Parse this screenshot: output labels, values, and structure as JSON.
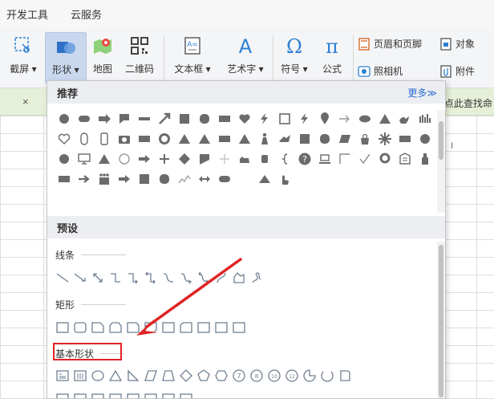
{
  "menu": {
    "dev_tools": "开发工具",
    "cloud": "云服务"
  },
  "ribbon": {
    "screenshot": "截屏",
    "shapes": "形状",
    "map": "地图",
    "qrcode": "二维码",
    "textbox": "文本框",
    "wordart": "艺术字",
    "symbol": "符号",
    "formula": "公式",
    "header_footer": "页眉和页脚",
    "object": "对象",
    "camera": "照相机",
    "attachment": "附件",
    "dropdown_arrow": "▾"
  },
  "sheet": {
    "close_tab": "×",
    "find_text": "点此查找命",
    "col_letter": "I"
  },
  "popup": {
    "recommended_title": "推荐",
    "more_link": "更多≫",
    "preset_title": "预设",
    "lines_title": "线条",
    "rect_title": "矩形",
    "basic_title": "基本形状"
  },
  "colors": {
    "shape_fill": "#6b6b6b",
    "outline_stroke": "#6f7f92",
    "highlight": "#e02424",
    "accent_blue": "#2c6dd2"
  }
}
